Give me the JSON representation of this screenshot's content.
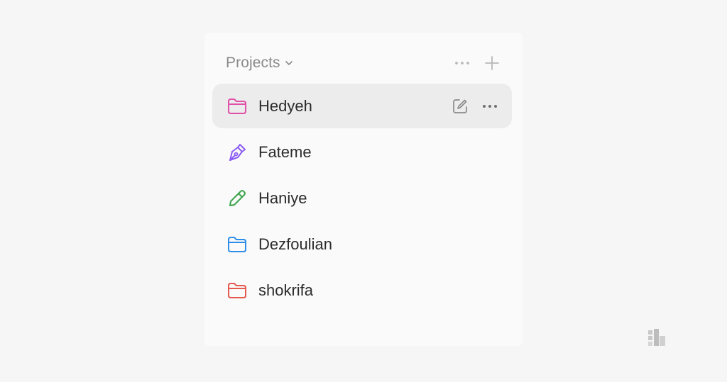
{
  "sidebar": {
    "section_title": "Projects",
    "projects": [
      {
        "label": "Hedyeh",
        "icon": "folder-icon",
        "color": "#e04fa8",
        "active": true
      },
      {
        "label": "Fateme",
        "icon": "pen-nib-icon",
        "color": "#8b5cf6",
        "active": false
      },
      {
        "label": "Haniye",
        "icon": "pencil-icon",
        "color": "#3aa34a",
        "active": false
      },
      {
        "label": "Dezfoulian",
        "icon": "folder-icon",
        "color": "#2f8ee8",
        "active": false
      },
      {
        "label": "shokrifa",
        "icon": "folder-icon",
        "color": "#e55a4f",
        "active": false
      }
    ]
  }
}
